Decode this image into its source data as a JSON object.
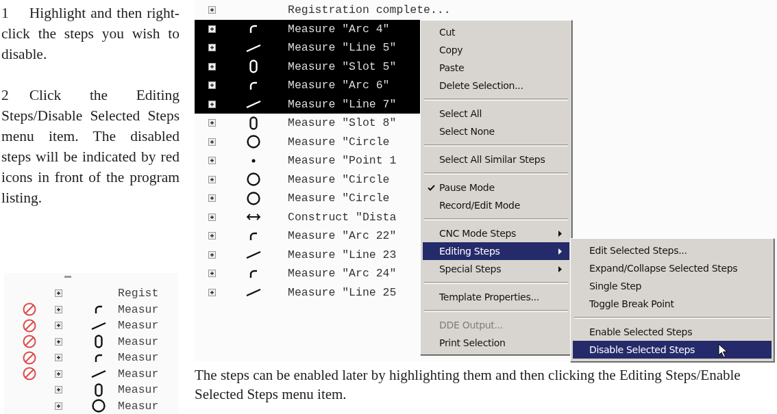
{
  "instructions": [
    {
      "number": "1",
      "text": "Highlight and then right-click the steps you wish to disable."
    },
    {
      "number": "2",
      "text": "Click the Editing Steps/Disable Selected Steps menu item. The disabled steps will be indicated by red icons in front of the program listing."
    }
  ],
  "listing_after": {
    "rows": [
      {
        "kind": "none",
        "text": "Regist",
        "disabled": false
      },
      {
        "kind": "arc",
        "text": "Measur",
        "disabled": true
      },
      {
        "kind": "line",
        "text": "Measur",
        "disabled": true
      },
      {
        "kind": "slot",
        "text": "Measur",
        "disabled": true
      },
      {
        "kind": "arc",
        "text": "Measur",
        "disabled": true
      },
      {
        "kind": "line",
        "text": "Measur",
        "disabled": true
      },
      {
        "kind": "slot",
        "text": "Measur",
        "disabled": false
      },
      {
        "kind": "circle",
        "text": "Measur",
        "disabled": false
      }
    ]
  },
  "listing": {
    "rows": [
      {
        "kind": "none",
        "text": "Registration complete...",
        "selected": false
      },
      {
        "kind": "arc",
        "text": "Measure \"Arc 4\"",
        "selected": true
      },
      {
        "kind": "line",
        "text": "Measure \"Line 5\"",
        "selected": true
      },
      {
        "kind": "slot",
        "text": "Measure \"Slot 5\"",
        "selected": true
      },
      {
        "kind": "arc",
        "text": "Measure \"Arc 6\"",
        "selected": true
      },
      {
        "kind": "line",
        "text": "Measure \"Line 7\"",
        "selected": true
      },
      {
        "kind": "slot",
        "text": "Measure \"Slot 8\"",
        "selected": false
      },
      {
        "kind": "circle",
        "text": "Measure \"Circle",
        "selected": false
      },
      {
        "kind": "point",
        "text": "Measure \"Point 1",
        "selected": false
      },
      {
        "kind": "circle",
        "text": "Measure \"Circle",
        "selected": false
      },
      {
        "kind": "circle",
        "text": "Measure \"Circle",
        "selected": false
      },
      {
        "kind": "distance",
        "text": "Construct \"Dista",
        "selected": false
      },
      {
        "kind": "arc",
        "text": "Measure \"Arc 22\"",
        "selected": false
      },
      {
        "kind": "line",
        "text": "Measure \"Line 23",
        "selected": false
      },
      {
        "kind": "arc",
        "text": "Measure \"Arc 24\"",
        "selected": false
      },
      {
        "kind": "line",
        "text": "Measure \"Line 25",
        "selected": false
      }
    ]
  },
  "context_menu": {
    "items": [
      {
        "kind": "item",
        "label": "Cut",
        "checked": false,
        "selected": false,
        "disabled": false,
        "submenu": false
      },
      {
        "kind": "item",
        "label": "Copy",
        "checked": false,
        "selected": false,
        "disabled": false,
        "submenu": false
      },
      {
        "kind": "item",
        "label": "Paste",
        "checked": false,
        "selected": false,
        "disabled": false,
        "submenu": false
      },
      {
        "kind": "item",
        "label": "Delete Selection...",
        "checked": false,
        "selected": false,
        "disabled": false,
        "submenu": false
      },
      {
        "kind": "separator"
      },
      {
        "kind": "item",
        "label": "Select All",
        "checked": false,
        "selected": false,
        "disabled": false,
        "submenu": false
      },
      {
        "kind": "item",
        "label": "Select None",
        "checked": false,
        "selected": false,
        "disabled": false,
        "submenu": false
      },
      {
        "kind": "separator"
      },
      {
        "kind": "item",
        "label": "Select All Similar Steps",
        "checked": false,
        "selected": false,
        "disabled": false,
        "submenu": false
      },
      {
        "kind": "separator"
      },
      {
        "kind": "item",
        "label": "Pause Mode",
        "checked": true,
        "selected": false,
        "disabled": false,
        "submenu": false
      },
      {
        "kind": "item",
        "label": "Record/Edit Mode",
        "checked": false,
        "selected": false,
        "disabled": false,
        "submenu": false
      },
      {
        "kind": "separator"
      },
      {
        "kind": "item",
        "label": "CNC Mode Steps",
        "checked": false,
        "selected": false,
        "disabled": false,
        "submenu": true
      },
      {
        "kind": "item",
        "label": "Editing Steps",
        "checked": false,
        "selected": true,
        "disabled": false,
        "submenu": true
      },
      {
        "kind": "item",
        "label": "Special Steps",
        "checked": false,
        "selected": false,
        "disabled": false,
        "submenu": true
      },
      {
        "kind": "separator"
      },
      {
        "kind": "item",
        "label": "Template Properties...",
        "checked": false,
        "selected": false,
        "disabled": false,
        "submenu": false
      },
      {
        "kind": "separator"
      },
      {
        "kind": "item",
        "label": "DDE Output...",
        "checked": false,
        "selected": false,
        "disabled": true,
        "submenu": false
      },
      {
        "kind": "item",
        "label": "Print Selection",
        "checked": false,
        "selected": false,
        "disabled": false,
        "submenu": false
      }
    ]
  },
  "submenu": {
    "items": [
      {
        "kind": "item",
        "label": "Edit Selected Steps...",
        "selected": false
      },
      {
        "kind": "item",
        "label": "Expand/Collapse Selected Steps",
        "selected": false
      },
      {
        "kind": "item",
        "label": "Single Step",
        "selected": false
      },
      {
        "kind": "item",
        "label": "Toggle Break Point",
        "selected": false
      },
      {
        "kind": "separator"
      },
      {
        "kind": "item",
        "label": "Enable Selected Steps",
        "selected": false
      },
      {
        "kind": "item",
        "label": "Disable Selected Steps",
        "selected": true
      }
    ]
  },
  "footer_text": "The steps can be enabled later by highlighting them and then clicking the Editing Steps/Enable Selected Steps menu item."
}
